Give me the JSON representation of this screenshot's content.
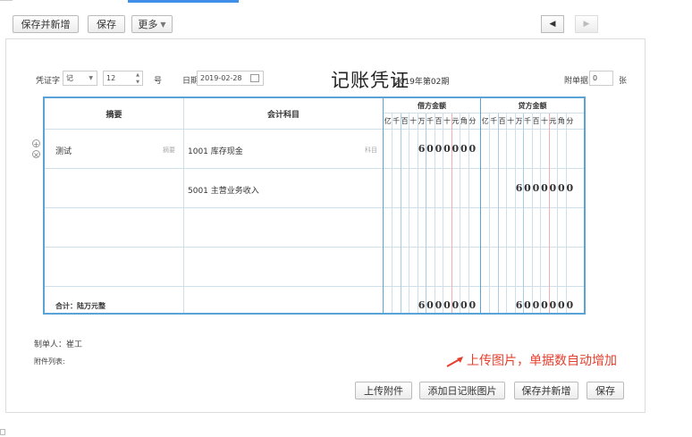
{
  "toolbar": {
    "save_new": "保存并新增",
    "save": "保存",
    "more": "更多",
    "prev": "◀",
    "next": "▶"
  },
  "voucher": {
    "word_label": "凭证字",
    "word_value": "记",
    "number_value": "12",
    "number_suffix": "号",
    "date_label": "日期",
    "date_value": "2019-02-28",
    "title": "记账凭证",
    "period": "2019年第02期",
    "attach_label": "附单据",
    "attach_value": "0",
    "attach_unit": "张"
  },
  "table": {
    "col_summary": "摘要",
    "col_account": "会计科目",
    "col_debit": "借方金额",
    "col_credit": "贷方金额",
    "digit_units": [
      "亿",
      "千",
      "百",
      "十",
      "万",
      "千",
      "百",
      "十",
      "元",
      "角",
      "分"
    ],
    "summary_hint": "摘要",
    "account_hint": "科目",
    "rows": [
      {
        "summary": "测试",
        "account": "1001 库存现金",
        "debit": "6000000",
        "credit": ""
      },
      {
        "summary": "",
        "account": "5001 主营业务收入",
        "debit": "",
        "credit": "6000000"
      },
      {
        "summary": "",
        "account": "",
        "debit": "",
        "credit": ""
      },
      {
        "summary": "",
        "account": "",
        "debit": "",
        "credit": ""
      }
    ],
    "total_label": "合计：陆万元整",
    "total_debit": "6000000",
    "total_credit": "6000000"
  },
  "footer": {
    "maker_label": "制单人：崔工",
    "attachments_label": "附件列表:",
    "upload_attachment": "上传附件",
    "add_image": "添加日记账图片",
    "save_new": "保存并新增",
    "save": "保存"
  },
  "annotation": "上传图片，单据数自动增加",
  "colors": {
    "accent": "#3f8fe8",
    "table_border": "#5aa3d6",
    "annotation": "#e53f2d"
  }
}
